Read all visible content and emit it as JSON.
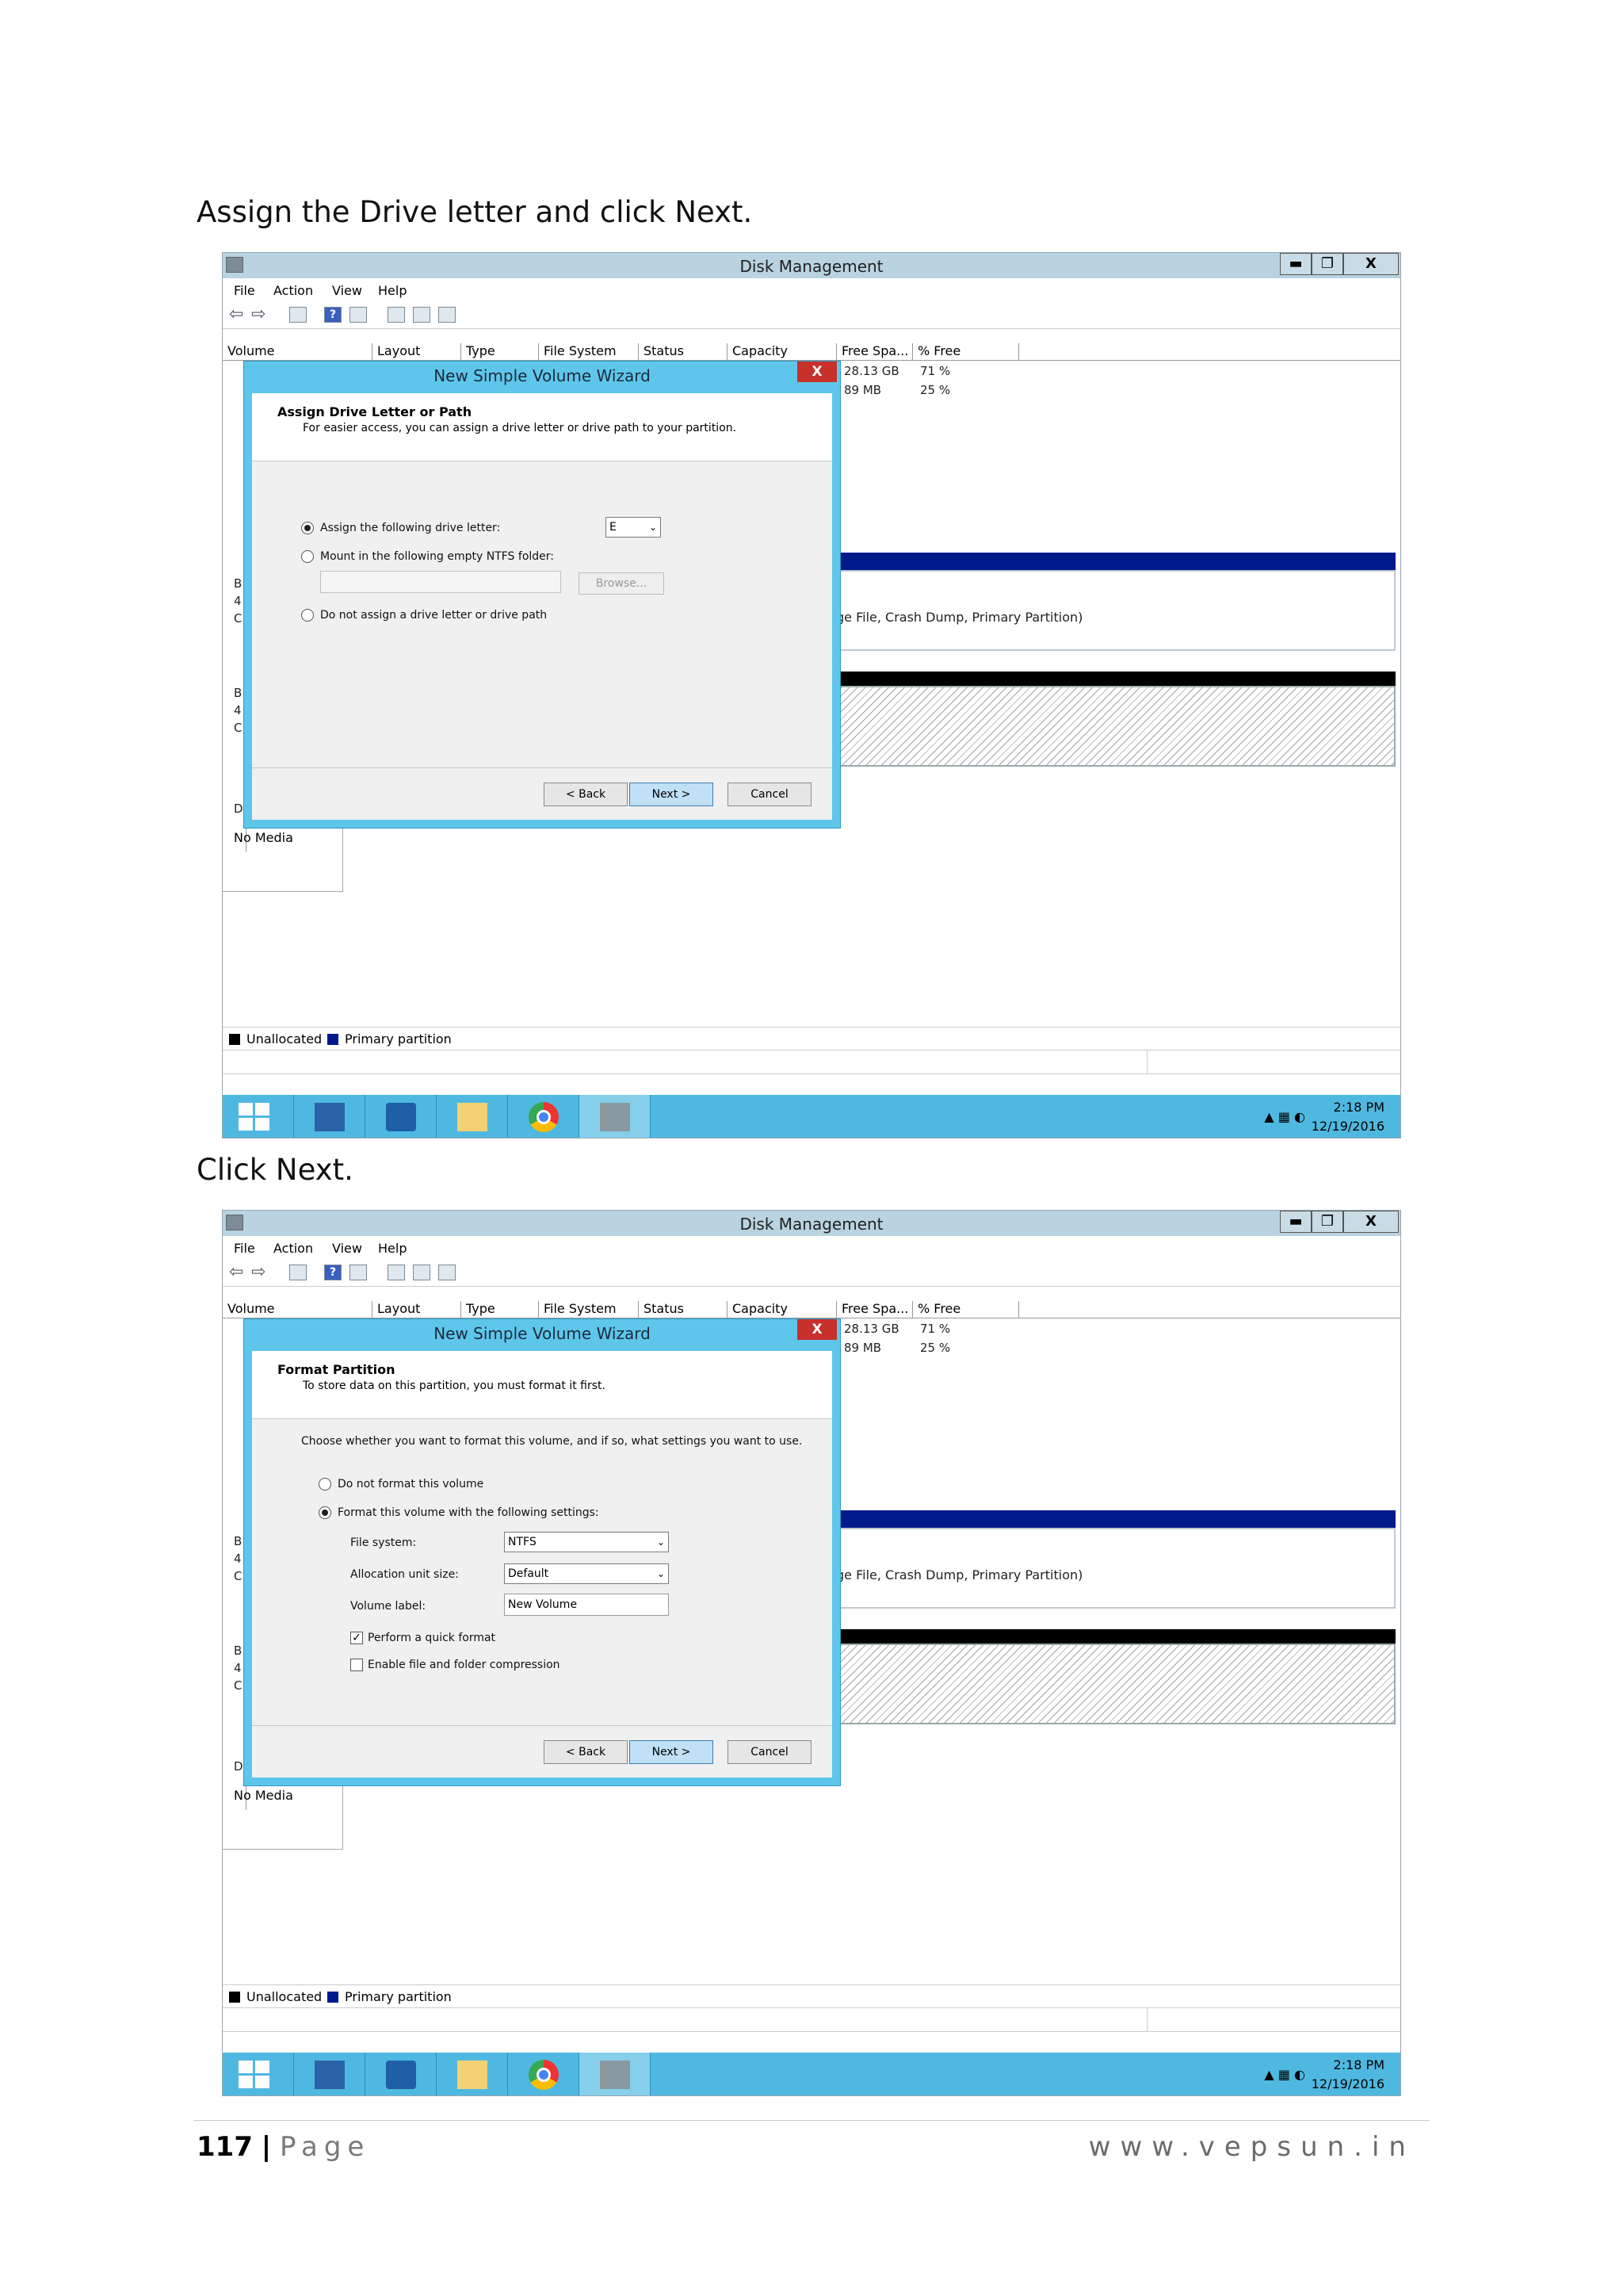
{
  "instructions": [
    "Assign the Drive letter and click Next.",
    "Click Next."
  ],
  "window": {
    "title": "Disk Management",
    "menu": [
      "File",
      "Action",
      "View",
      "Help"
    ],
    "winbtns": [
      "▬",
      "❐",
      "X"
    ],
    "columns": [
      "Volume",
      "Layout",
      "Type",
      "File System",
      "Status",
      "Capacity",
      "Free Spa...",
      "% Free"
    ],
    "rows": [
      {
        "free": "28.13 GB",
        "pct": "71 %"
      },
      {
        "free": "89 MB",
        "pct": "25 %"
      }
    ],
    "left_labels": [
      "B",
      "4",
      "C",
      "B",
      "4",
      "C",
      "D"
    ],
    "partition_text": "ge File, Crash Dump, Primary Partition)",
    "no_media": "No Media",
    "legend": [
      {
        "label": "Unallocated",
        "color": "#000000"
      },
      {
        "label": "Primary partition",
        "color": "#001a8c"
      }
    ],
    "clock_time": "2:18 PM",
    "clock_date": "12/19/2016",
    "tray_arrow": "▲"
  },
  "wizard": {
    "title": "New Simple Volume Wizard",
    "close": "X",
    "back": "< Back",
    "next": "Next >",
    "cancel": "Cancel"
  },
  "step1": {
    "head_title": "Assign Drive Letter or Path",
    "head_desc": "For easier access, you can assign a drive letter or drive path to your partition.",
    "opt_assign": "Assign the following drive letter:",
    "drive_letter": "E",
    "opt_mount": "Mount in the following empty NTFS folder:",
    "browse": "Browse...",
    "opt_none": "Do not assign a drive letter or drive path"
  },
  "step2": {
    "head_title": "Format Partition",
    "head_desc": "To store data on this partition, you must format it first.",
    "intro": "Choose whether you want to format this volume, and if so, what settings you want to use.",
    "opt_noformat": "Do not format this volume",
    "opt_format": "Format this volume with the following settings:",
    "fs_label": "File system:",
    "fs_value": "NTFS",
    "alloc_label": "Allocation unit size:",
    "alloc_value": "Default",
    "vol_label": "Volume label:",
    "vol_value": "New Volume",
    "quick": "Perform a quick format",
    "quick_checked": true,
    "compress": "Enable file and folder compression"
  },
  "footer": {
    "page_number": "117",
    "separator": "|",
    "page_word": "Page",
    "website": "www.vepsun.in"
  }
}
